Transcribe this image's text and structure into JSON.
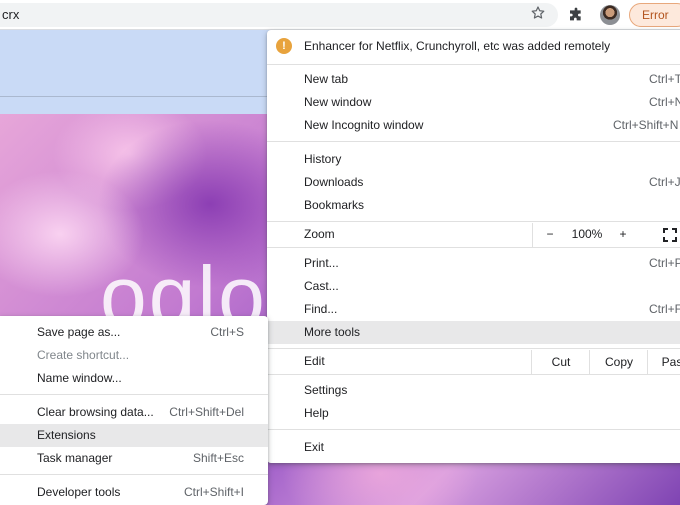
{
  "toolbar": {
    "url_text": "crx",
    "error_label": "Error"
  },
  "background": {
    "logo_fragment": "oglo"
  },
  "notification": {
    "icon": "warning-icon",
    "text": "Enhancer for Netflix, Crunchyroll, etc was added remotely"
  },
  "main_menu": {
    "new_tab": {
      "label": "New tab",
      "shortcut": "Ctrl+T"
    },
    "new_window": {
      "label": "New window",
      "shortcut": "Ctrl+N"
    },
    "new_incognito": {
      "label": "New Incognito window",
      "shortcut": "Ctrl+Shift+N"
    },
    "history": {
      "label": "History"
    },
    "downloads": {
      "label": "Downloads",
      "shortcut": "Ctrl+J"
    },
    "bookmarks": {
      "label": "Bookmarks"
    },
    "zoom": {
      "label": "Zoom",
      "minus": "−",
      "level": "100%",
      "plus": "+"
    },
    "print": {
      "label": "Print...",
      "shortcut": "Ctrl+P"
    },
    "cast": {
      "label": "Cast..."
    },
    "find": {
      "label": "Find...",
      "shortcut": "Ctrl+F"
    },
    "more_tools": {
      "label": "More tools"
    },
    "edit": {
      "label": "Edit",
      "cut": "Cut",
      "copy": "Copy",
      "paste": "Paste"
    },
    "settings": {
      "label": "Settings"
    },
    "help": {
      "label": "Help"
    },
    "exit": {
      "label": "Exit"
    }
  },
  "sub_menu": {
    "save_page": {
      "label": "Save page as...",
      "shortcut": "Ctrl+S"
    },
    "create_shortcut": {
      "label": "Create shortcut..."
    },
    "name_window": {
      "label": "Name window..."
    },
    "clear_data": {
      "label": "Clear browsing data...",
      "shortcut": "Ctrl+Shift+Del"
    },
    "extensions": {
      "label": "Extensions"
    },
    "task_manager": {
      "label": "Task manager",
      "shortcut": "Shift+Esc"
    },
    "dev_tools": {
      "label": "Developer tools",
      "shortcut": "Ctrl+Shift+I"
    }
  },
  "colors": {
    "accent_blue": "#c9daf6",
    "error_orange": "#b3541e",
    "highlight": "#e8e8e9"
  }
}
